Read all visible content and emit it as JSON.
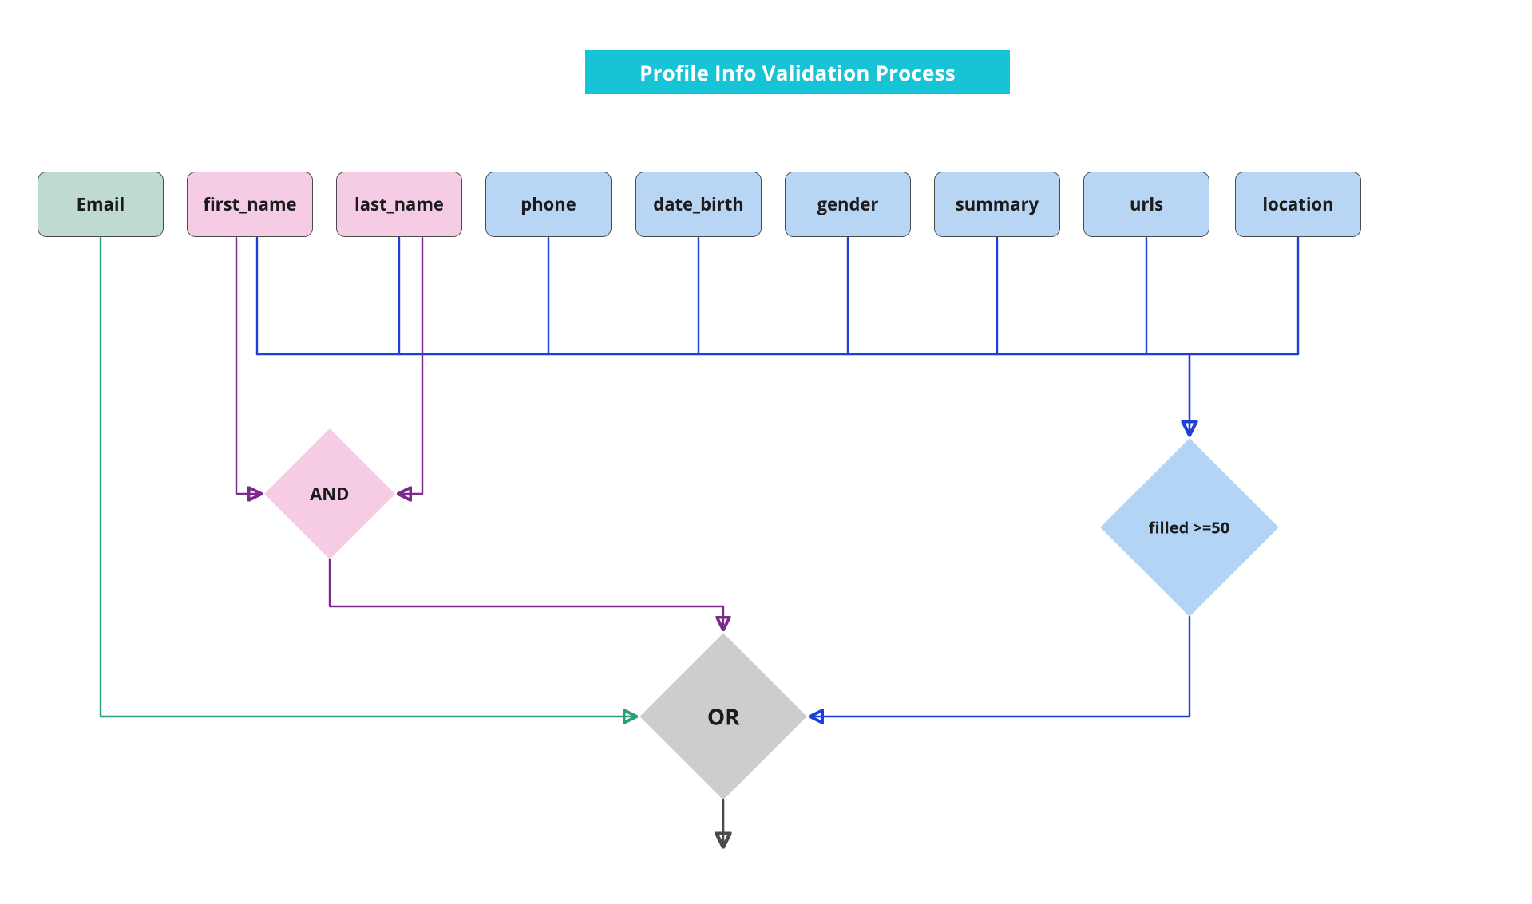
{
  "title": "Profile Info Validation Process",
  "nodes": {
    "email": "Email",
    "first_name": "first_name",
    "last_name": "last_name",
    "phone": "phone",
    "date_birth": "date_birth",
    "gender": "gender",
    "summary": "summary",
    "urls": "urls",
    "location": "location"
  },
  "gates": {
    "and": "AND",
    "filled": "filled >=50",
    "or": "OR"
  },
  "colors": {
    "title_bg": "#17c4d6",
    "email_edge": "#2a9d7a",
    "name_edge": "#7b2a8a",
    "blue_edge": "#1f3fd6",
    "gray_edge": "#4a4a4a"
  }
}
